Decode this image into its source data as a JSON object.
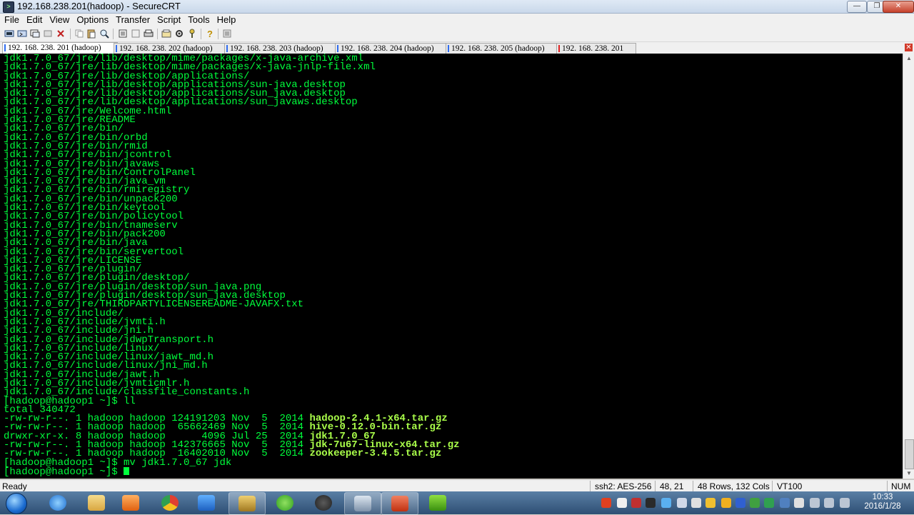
{
  "window": {
    "title": "192.168.238.201(hadoop) - SecureCRT"
  },
  "menu": [
    "File",
    "Edit",
    "View",
    "Options",
    "Transfer",
    "Script",
    "Tools",
    "Help"
  ],
  "tabs": [
    {
      "label": "192. 168. 238. 201 (hadoop)",
      "active": true
    },
    {
      "label": "192. 168. 238. 202 (hadoop)",
      "active": false
    },
    {
      "label": "192. 168. 238. 203 (hadoop)",
      "active": false
    },
    {
      "label": "192. 168. 238. 204 (hadoop)",
      "active": false
    },
    {
      "label": "192. 168. 238. 205 (hadoop)",
      "active": false
    },
    {
      "label": "192. 168. 238. 201",
      "active": false
    }
  ],
  "terminal": {
    "lines": [
      "jdk1.7.0_67/jre/lib/desktop/mime/packages/x-java-archive.xml",
      "jdk1.7.0_67/jre/lib/desktop/mime/packages/x-java-jnlp-file.xml",
      "jdk1.7.0_67/jre/lib/desktop/applications/",
      "jdk1.7.0_67/jre/lib/desktop/applications/sun-java.desktop",
      "jdk1.7.0_67/jre/lib/desktop/applications/sun_java.desktop",
      "jdk1.7.0_67/jre/lib/desktop/applications/sun_javaws.desktop",
      "jdk1.7.0_67/jre/Welcome.html",
      "jdk1.7.0_67/jre/README",
      "jdk1.7.0_67/jre/bin/",
      "jdk1.7.0_67/jre/bin/orbd",
      "jdk1.7.0_67/jre/bin/rmid",
      "jdk1.7.0_67/jre/bin/jcontrol",
      "jdk1.7.0_67/jre/bin/javaws",
      "jdk1.7.0_67/jre/bin/ControlPanel",
      "jdk1.7.0_67/jre/bin/java_vm",
      "jdk1.7.0_67/jre/bin/rmiregistry",
      "jdk1.7.0_67/jre/bin/unpack200",
      "jdk1.7.0_67/jre/bin/keytool",
      "jdk1.7.0_67/jre/bin/policytool",
      "jdk1.7.0_67/jre/bin/tnameserv",
      "jdk1.7.0_67/jre/bin/pack200",
      "jdk1.7.0_67/jre/bin/java",
      "jdk1.7.0_67/jre/bin/servertool",
      "jdk1.7.0_67/jre/LICENSE",
      "jdk1.7.0_67/jre/plugin/",
      "jdk1.7.0_67/jre/plugin/desktop/",
      "jdk1.7.0_67/jre/plugin/desktop/sun_java.png",
      "jdk1.7.0_67/jre/plugin/desktop/sun_java.desktop",
      "jdk1.7.0_67/jre/THIRDPARTYLICENSEREADME-JAVAFX.txt",
      "jdk1.7.0_67/include/",
      "jdk1.7.0_67/include/jvmti.h",
      "jdk1.7.0_67/include/jni.h",
      "jdk1.7.0_67/include/jdwpTransport.h",
      "jdk1.7.0_67/include/linux/",
      "jdk1.7.0_67/include/linux/jawt_md.h",
      "jdk1.7.0_67/include/linux/jni_md.h",
      "jdk1.7.0_67/include/jawt.h",
      "jdk1.7.0_67/include/jvmticmlr.h",
      "jdk1.7.0_67/include/classfile_constants.h",
      "[hadoop@hadoop1 ~]$ ll",
      "total 340472"
    ],
    "listing": [
      {
        "prefix": "-rw-rw-r--. 1 hadoop hadoop 124191203 Nov  5  2014 ",
        "name": "hadoop-2.4.1-x64.tar.gz"
      },
      {
        "prefix": "-rw-rw-r--. 1 hadoop hadoop  65662469 Nov  5  2014 ",
        "name": "hive-0.12.0-bin.tar.gz"
      },
      {
        "prefix": "drwxr-xr-x. 8 hadoop hadoop      4096 Jul 25  2014 ",
        "name": "jdk1.7.0_67"
      },
      {
        "prefix": "-rw-rw-r--. 1 hadoop hadoop 142376665 Nov  5  2014 ",
        "name": "jdk-7u67-linux-x64.tar.gz"
      },
      {
        "prefix": "-rw-rw-r--. 1 hadoop hadoop  16402010 Nov  5  2014 ",
        "name": "zookeeper-3.4.5.tar.gz"
      }
    ],
    "after": [
      "[hadoop@hadoop1 ~]$ mv jdk1.7.0_67 jdk"
    ],
    "prompt": "[hadoop@hadoop1 ~]$ "
  },
  "status": {
    "ready": "Ready",
    "cipher": "ssh2: AES-256",
    "position": "48, 21",
    "size": "48 Rows, 132 Cols",
    "emulation": "VT100",
    "num": "NUM"
  },
  "clock": {
    "time": "10:33",
    "date": "2016/1/28"
  },
  "colors": {
    "terminal_bg": "#000000",
    "terminal_fg": "#00ff3c",
    "filename": "#aaff4a"
  }
}
